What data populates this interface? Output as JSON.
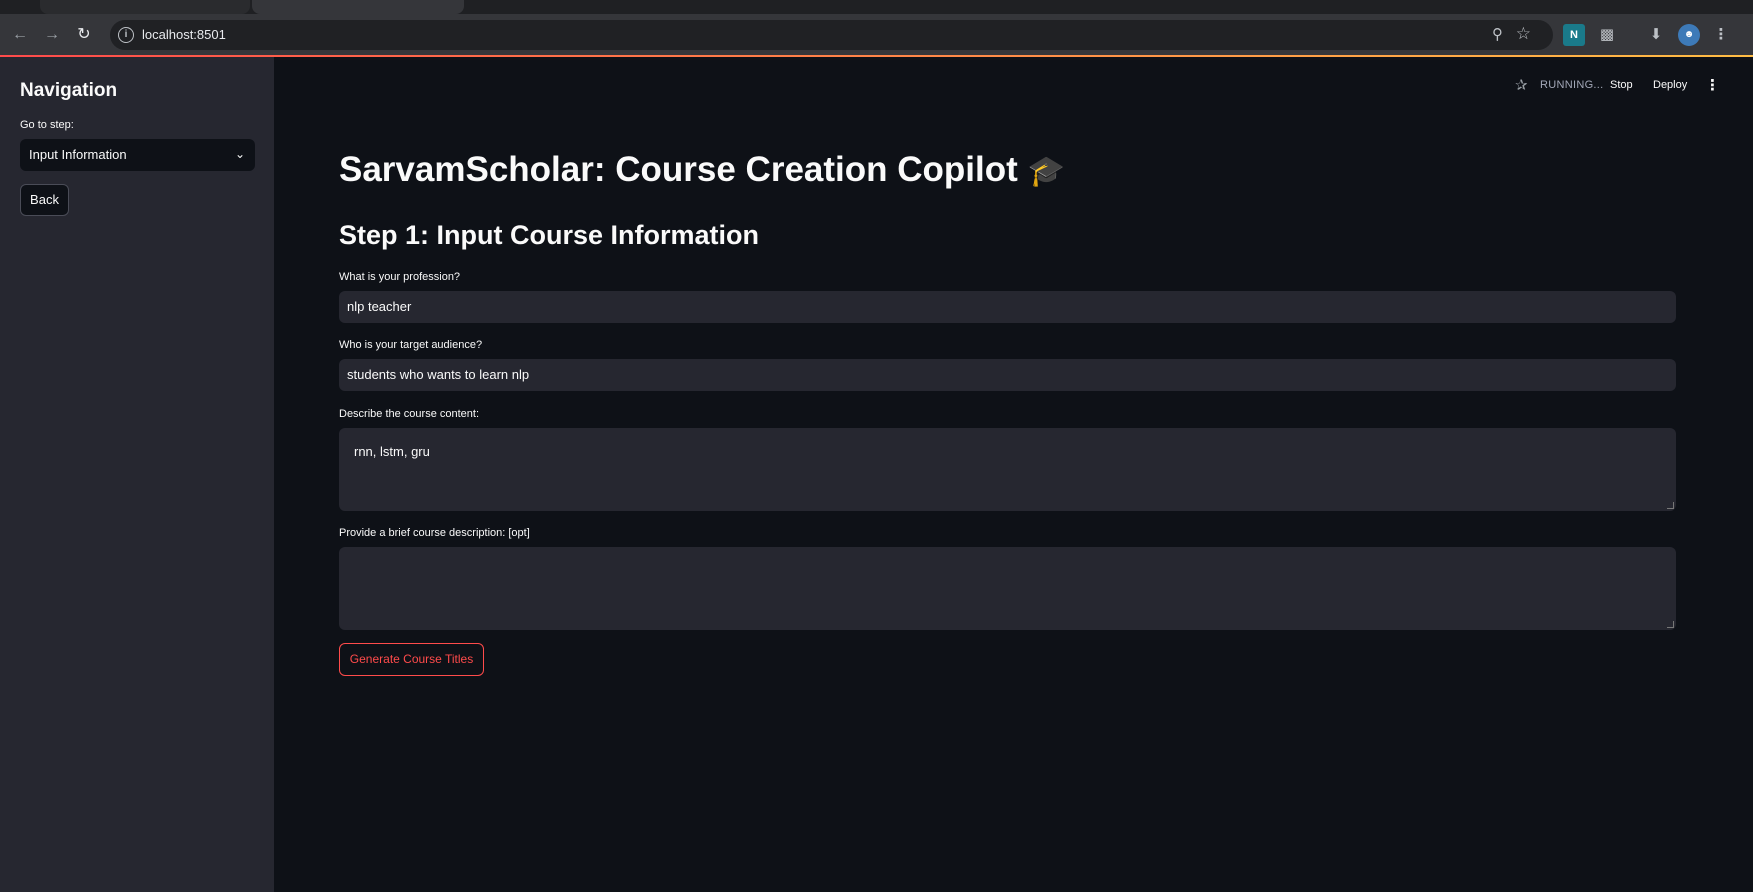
{
  "browser": {
    "url": "localhost:8501",
    "back_icon": "arrow-left-icon",
    "forward_icon": "arrow-right-icon",
    "reload_icon": "reload-icon"
  },
  "status": {
    "running": "RUNNING...",
    "stop": "Stop",
    "deploy": "Deploy"
  },
  "sidebar": {
    "title": "Navigation",
    "step_label": "Go to step:",
    "step_value": "Input Information",
    "back": "Back"
  },
  "main": {
    "title": "SarvamScholar: Course Creation Copilot",
    "title_emoji": "🎓",
    "step_heading": "Step 1: Input Course Information",
    "fields": [
      {
        "label": "What is your profession?",
        "value": "nlp teacher"
      },
      {
        "label": "Who is your target audience?",
        "value": "students who wants to learn nlp"
      },
      {
        "label": "Describe the course content:",
        "value": "rnn, lstm, gru"
      },
      {
        "label": "Provide a brief course description: [opt]",
        "value": ""
      }
    ],
    "generate_button": "Generate Course Titles"
  },
  "colors": {
    "accent": "#ff4b4b",
    "sidebar_bg": "#262730",
    "main_bg": "#0e1117"
  }
}
